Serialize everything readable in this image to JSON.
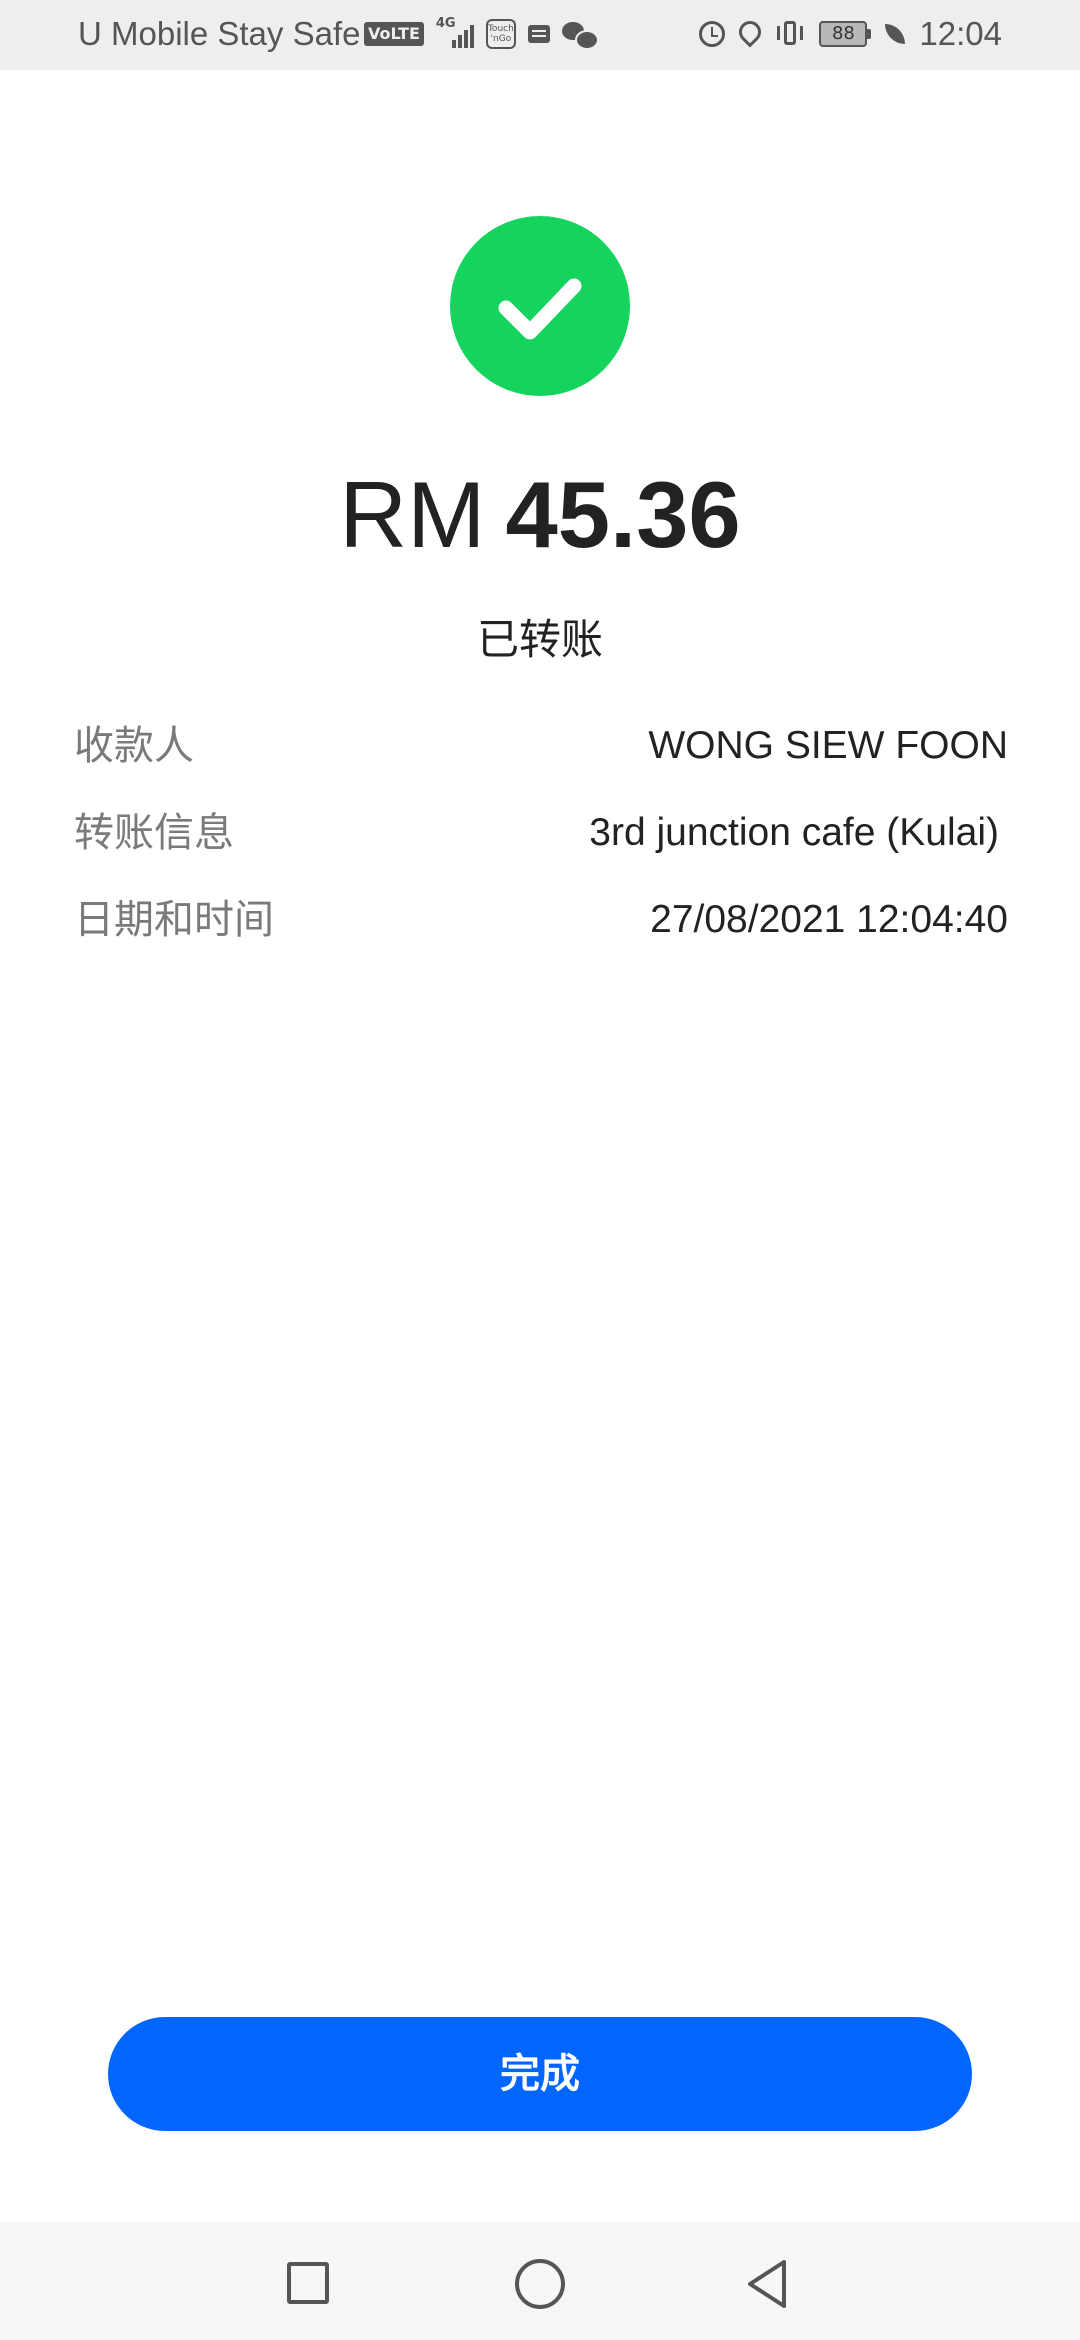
{
  "status_bar": {
    "carrier": "U Mobile Stay Safe",
    "volte": "VoLTE",
    "network": "4G",
    "tng_line1": "Touch",
    "tng_line2": "'nGo",
    "battery": "88",
    "time": "12:04"
  },
  "icons": {
    "success": "check-circle-icon",
    "alarm": "alarm-icon",
    "location": "location-icon",
    "vibrate": "vibrate-icon",
    "battery": "battery-icon",
    "leaf": "leaf-icon",
    "message": "message-icon",
    "wechat": "wechat-icon"
  },
  "colors": {
    "success": "#14d45e",
    "primary": "#0066ff",
    "label": "#7a7a7a",
    "text": "#222222"
  },
  "receipt": {
    "currency": "RM",
    "amount": "45.36",
    "status": "已转账",
    "payee_label": "收款人",
    "payee_value": "WONG SIEW FOON",
    "info_label": "转账信息",
    "info_value": "3rd junction cafe (Kulai)",
    "datetime_label": "日期和时间",
    "datetime_value": "27/08/2021 12:04:40"
  },
  "actions": {
    "done_label": "完成"
  },
  "nav": {
    "recent": "recent-apps-button",
    "home": "home-button",
    "back": "back-button"
  }
}
